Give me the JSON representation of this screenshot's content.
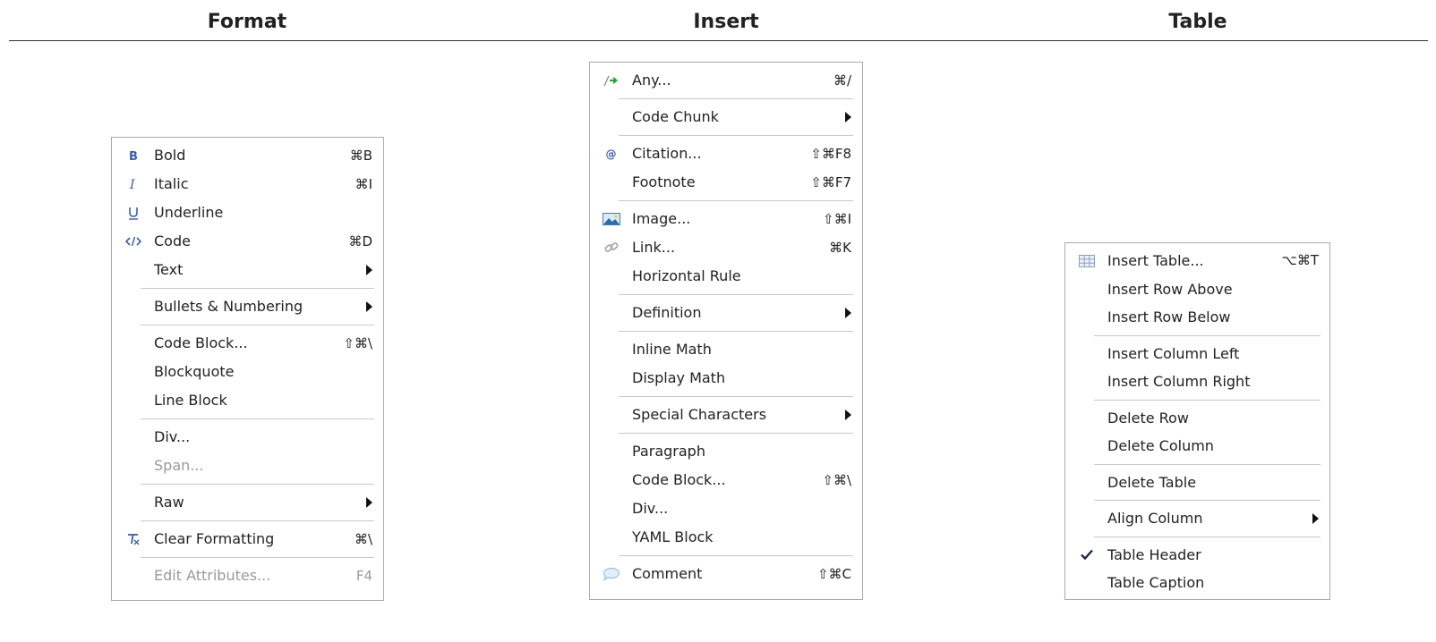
{
  "headers": {
    "format": "Format",
    "insert": "Insert",
    "table": "Table"
  },
  "format_menu": {
    "items": [
      {
        "icon": "bold-icon",
        "label": "Bold",
        "shortcut": "⌘B"
      },
      {
        "icon": "italic-icon",
        "label": "Italic",
        "shortcut": "⌘I"
      },
      {
        "icon": "underline-icon",
        "label": "Underline",
        "shortcut": ""
      },
      {
        "icon": "code-icon",
        "label": "Code",
        "shortcut": "⌘D"
      },
      {
        "label": "Text",
        "submenu": true
      },
      {
        "label": "Bullets & Numbering",
        "submenu": true
      },
      {
        "label": "Code Block...",
        "shortcut": "⇧⌘\\"
      },
      {
        "label": "Blockquote"
      },
      {
        "label": "Line Block"
      },
      {
        "label": "Div..."
      },
      {
        "label": "Span...",
        "disabled": true
      },
      {
        "label": "Raw",
        "submenu": true
      },
      {
        "icon": "clear-formatting-icon",
        "label": "Clear Formatting",
        "shortcut": "⌘\\"
      },
      {
        "label": "Edit Attributes...",
        "shortcut": "F4",
        "disabled": true
      }
    ]
  },
  "insert_menu": {
    "items": [
      {
        "icon": "any-insert-icon",
        "label": "Any...",
        "shortcut": "⌘/"
      },
      {
        "label": "Code Chunk",
        "submenu": true
      },
      {
        "icon": "citation-icon",
        "label": "Citation...",
        "shortcut": "⇧⌘F8"
      },
      {
        "label": "Footnote",
        "shortcut": "⇧⌘F7"
      },
      {
        "icon": "image-icon",
        "label": "Image...",
        "shortcut": "⇧⌘I"
      },
      {
        "icon": "link-icon",
        "label": "Link...",
        "shortcut": "⌘K"
      },
      {
        "label": "Horizontal Rule"
      },
      {
        "label": "Definition",
        "submenu": true
      },
      {
        "label": "Inline Math"
      },
      {
        "label": "Display Math"
      },
      {
        "label": "Special Characters",
        "submenu": true
      },
      {
        "label": "Paragraph"
      },
      {
        "label": "Code Block...",
        "shortcut": "⇧⌘\\"
      },
      {
        "label": "Div..."
      },
      {
        "label": "YAML Block"
      },
      {
        "icon": "comment-icon",
        "label": "Comment",
        "shortcut": "⇧⌘C"
      }
    ]
  },
  "table_menu": {
    "items": [
      {
        "icon": "table-icon",
        "label": "Insert Table...",
        "shortcut": "⌥⌘T"
      },
      {
        "label": "Insert Row Above"
      },
      {
        "label": "Insert Row Below"
      },
      {
        "label": "Insert Column Left"
      },
      {
        "label": "Insert Column Right"
      },
      {
        "label": "Delete Row"
      },
      {
        "label": "Delete Column"
      },
      {
        "label": "Delete Table"
      },
      {
        "label": "Align Column",
        "submenu": true
      },
      {
        "icon": "checkmark-icon",
        "label": "Table Header",
        "checked": true
      },
      {
        "label": "Table Caption"
      }
    ]
  }
}
